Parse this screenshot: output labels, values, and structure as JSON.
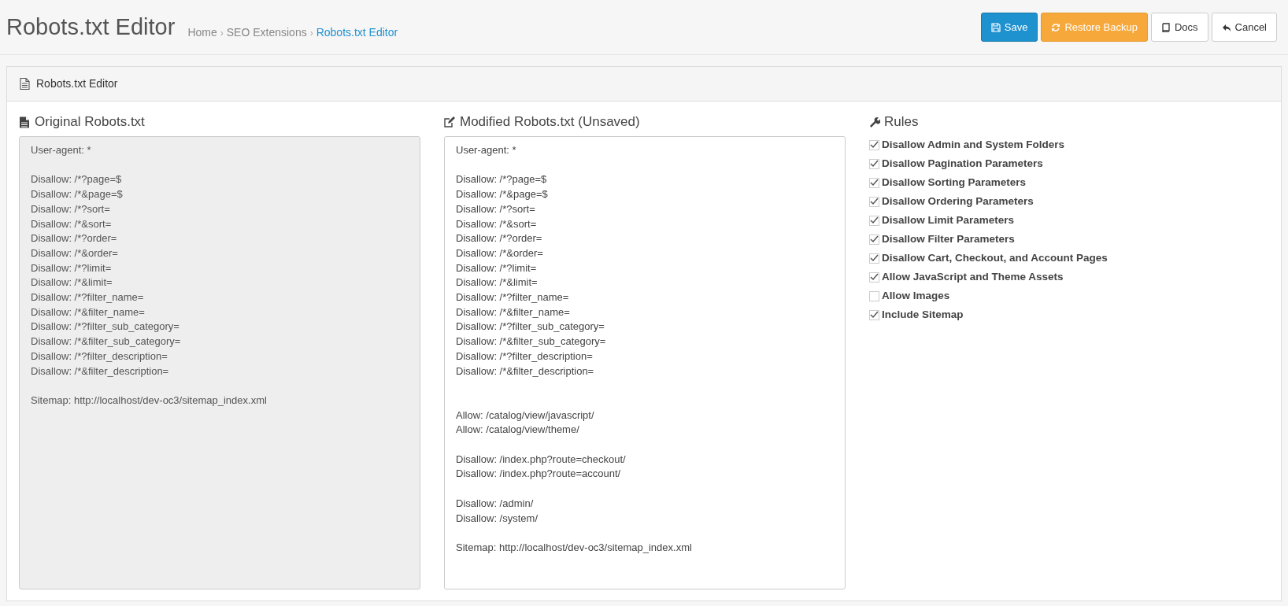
{
  "header": {
    "title": "Robots.txt Editor",
    "breadcrumbs": [
      {
        "label": "Home",
        "selected": false
      },
      {
        "separator": "›",
        "label": "SEO Extensions",
        "selected": false
      },
      {
        "separator": "›",
        "label": "Robots.txt Editor",
        "selected": true
      }
    ],
    "buttons": [
      {
        "kind": "save",
        "label": "Save"
      },
      {
        "kind": "restore",
        "label": "Restore Backup"
      },
      {
        "kind": "docs",
        "label": "Docs"
      },
      {
        "kind": "cancel",
        "label": "Cancel"
      }
    ]
  },
  "panel": {
    "title": "Robots.txt Editor",
    "original": {
      "title": "Original Robots.txt",
      "disabled": true,
      "text": "User-agent: *\n\nDisallow: /*?page=$\nDisallow: /*&page=$\nDisallow: /*?sort=\nDisallow: /*&sort=\nDisallow: /*?order=\nDisallow: /*&order=\nDisallow: /*?limit=\nDisallow: /*&limit=\nDisallow: /*?filter_name=\nDisallow: /*&filter_name=\nDisallow: /*?filter_sub_category=\nDisallow: /*&filter_sub_category=\nDisallow: /*?filter_description=\nDisallow: /*&filter_description=\n\nSitemap: http://localhost/dev-oc3/sitemap_index.xml"
    },
    "modified": {
      "title": "Modified Robots.txt (Unsaved)",
      "disabled": false,
      "text": "User-agent: *\n\nDisallow: /*?page=$\nDisallow: /*&page=$\nDisallow: /*?sort=\nDisallow: /*&sort=\nDisallow: /*?order=\nDisallow: /*&order=\nDisallow: /*?limit=\nDisallow: /*&limit=\nDisallow: /*?filter_name=\nDisallow: /*&filter_name=\nDisallow: /*?filter_sub_category=\nDisallow: /*&filter_sub_category=\nDisallow: /*?filter_description=\nDisallow: /*&filter_description=\n\n\nAllow: /catalog/view/javascript/\nAllow: /catalog/view/theme/\n\nDisallow: /index.php?route=checkout/\nDisallow: /index.php?route=account/\n\nDisallow: /admin/\nDisallow: /system/\n\nSitemap: http://localhost/dev-oc3/sitemap_index.xml"
    },
    "rules": {
      "title": "Rules",
      "items": [
        {
          "label": "Disallow Admin and System Folders",
          "checked": true
        },
        {
          "label": "Disallow Pagination Parameters",
          "checked": true
        },
        {
          "label": "Disallow Sorting Parameters",
          "checked": true
        },
        {
          "label": "Disallow Ordering Parameters",
          "checked": true
        },
        {
          "label": "Disallow Limit Parameters",
          "checked": true
        },
        {
          "label": "Disallow Filter Parameters",
          "checked": true
        },
        {
          "label": "Disallow Cart, Checkout, and Account Pages",
          "checked": true
        },
        {
          "label": "Allow JavaScript and Theme Assets",
          "checked": true
        },
        {
          "label": "Allow Images",
          "checked": false
        },
        {
          "label": "Include Sitemap",
          "checked": true
        }
      ]
    }
  }
}
